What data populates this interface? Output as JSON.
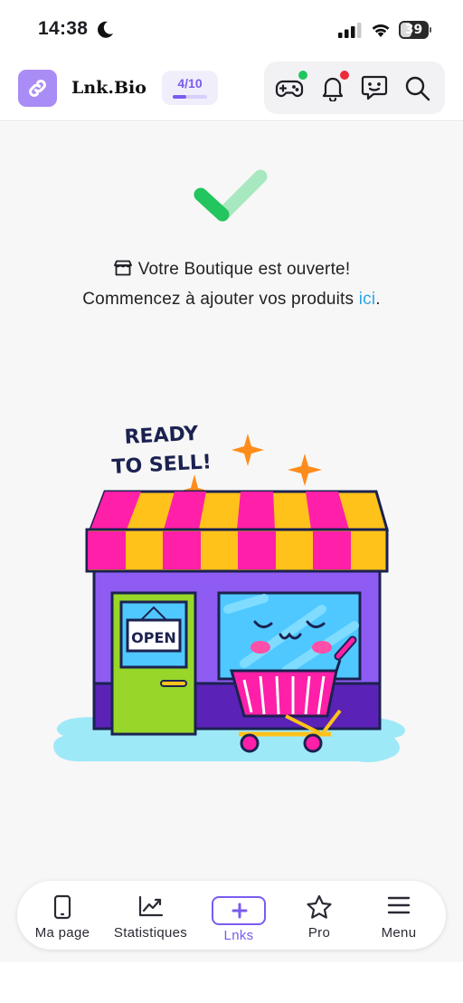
{
  "status_bar": {
    "time": "14:38",
    "battery_level": "39"
  },
  "header": {
    "brand": "Lnk.Bio",
    "progress_label": "4/10",
    "progress_fraction": 0.4,
    "icons": [
      "gamepad-icon",
      "bell-icon",
      "chat-icon",
      "search-icon"
    ],
    "badge_colors": {
      "gamepad": "#21c55d",
      "bell": "#ef2b3a"
    },
    "accent": "#7a5cf0",
    "logo_bg": "#a98cf5"
  },
  "main": {
    "message_line1": "Votre Boutique est ouverte!",
    "message_line2_prefix": "Commencez à ajouter vos produits ",
    "message_line2_link": "ici",
    "message_line2_suffix": ".",
    "link_color": "#2aa7e8",
    "illustration": {
      "headline_1": "READY",
      "headline_2": "TO SELL!",
      "sign": "OPEN"
    }
  },
  "bottom_nav": {
    "items": [
      {
        "label": "Ma page",
        "icon": "phone-icon"
      },
      {
        "label": "Statistiques",
        "icon": "chart-icon"
      },
      {
        "label": "Lnks",
        "icon": "plus-icon"
      },
      {
        "label": "Pro",
        "icon": "star-icon"
      },
      {
        "label": "Menu",
        "icon": "menu-icon"
      }
    ],
    "active_index": 2
  }
}
